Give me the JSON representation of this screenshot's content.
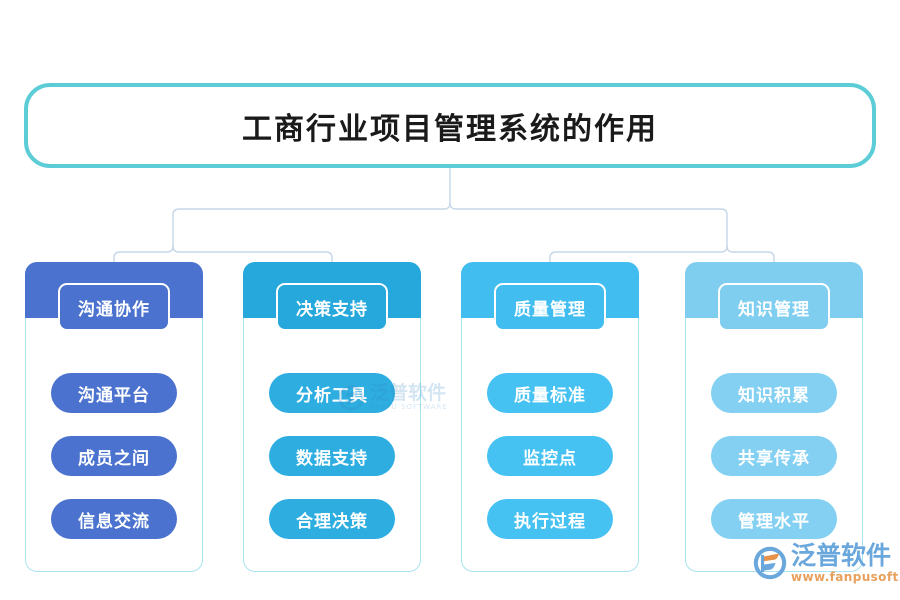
{
  "diagram": {
    "title": "工商行业项目管理系统的作用",
    "title_border_color": "#5ccdd6",
    "connector_color": "#c5d6e8",
    "columns": [
      {
        "id": "communication",
        "header": "沟通协作",
        "color": "#4a72ce",
        "items": [
          "沟通平台",
          "成员之间",
          "信息交流"
        ]
      },
      {
        "id": "decision-support",
        "header": "决策支持",
        "color": "#26a8dd",
        "items": [
          "分析工具",
          "数据支持",
          "合理决策"
        ]
      },
      {
        "id": "quality-management",
        "header": "质量管理",
        "color": "#41bdf0",
        "items": [
          "质量标准",
          "监控点",
          "执行过程"
        ]
      },
      {
        "id": "knowledge-management",
        "header": "知识管理",
        "color": "#7fcef0",
        "items": [
          "知识积累",
          "共享传承",
          "管理水平"
        ]
      }
    ]
  },
  "watermark": {
    "company_cn": "泛普软件",
    "company_en": "FANPU SOFTWARE"
  },
  "brand": {
    "name_cn": "泛普软件",
    "url": "www.fanpusoft.com",
    "text_color": "#6aa7dc",
    "url_color": "#e8a05c"
  }
}
